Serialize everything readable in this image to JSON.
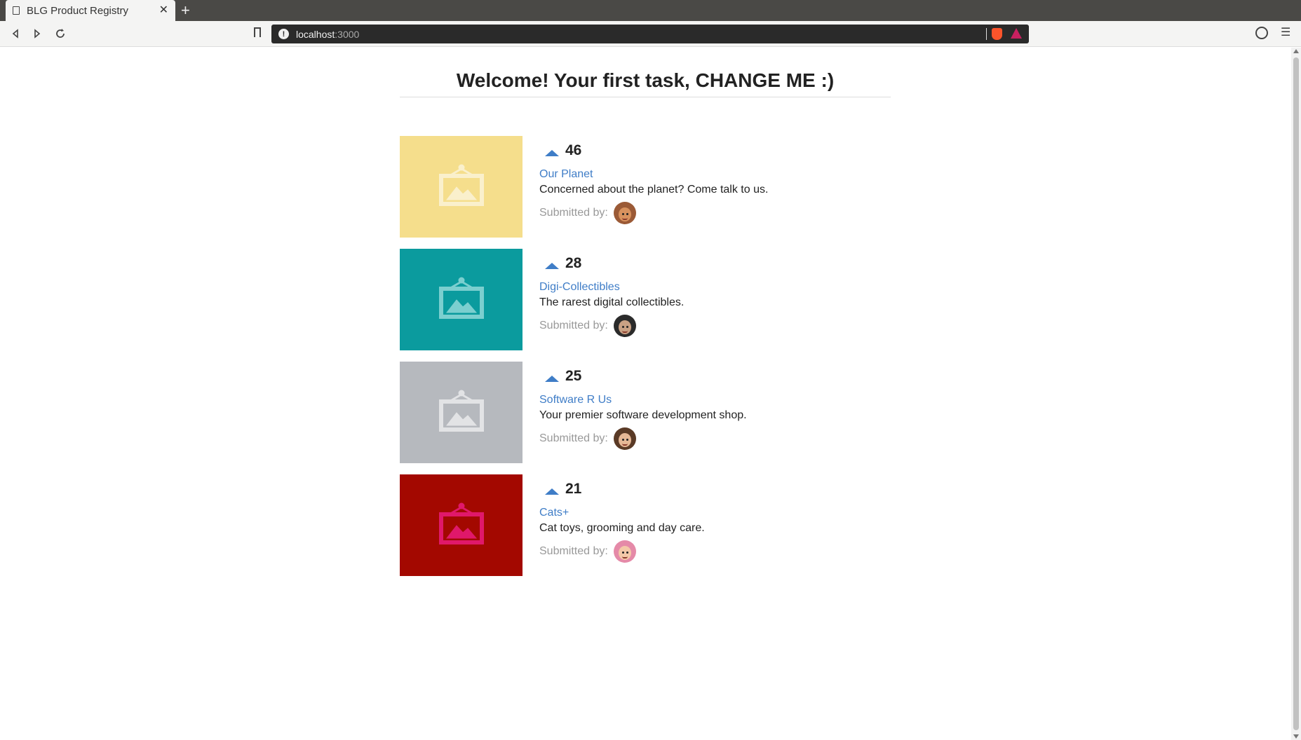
{
  "browser": {
    "tab_title": "BLG Product Registry",
    "tab_close": "✕",
    "new_tab": "+",
    "url_host": "localhost",
    "url_port": ":3000"
  },
  "page": {
    "title": "Welcome! Your first task, CHANGE ME :)"
  },
  "products": [
    {
      "votes": "46",
      "name": "Our Planet",
      "description": "Concerned about the planet? Come talk to us.",
      "submitted_label": "Submitted by:",
      "thumb_color": "#f5de8c",
      "icon_color": "#faf0cc",
      "avatar_bg": "#9b5a36",
      "avatar_face": "#d8925e"
    },
    {
      "votes": "28",
      "name": "Digi-Collectibles",
      "description": "The rarest digital collectibles.",
      "submitted_label": "Submitted by:",
      "thumb_color": "#0b9b9e",
      "icon_color": "#7bcfcf",
      "avatar_bg": "#2b2b2b",
      "avatar_face": "#c9a184"
    },
    {
      "votes": "25",
      "name": "Software R Us",
      "description": "Your premier software development shop.",
      "submitted_label": "Submitted by:",
      "thumb_color": "#b6b9be",
      "icon_color": "#e2e3e5",
      "avatar_bg": "#5a3a26",
      "avatar_face": "#e6b896"
    },
    {
      "votes": "21",
      "name": "Cats+",
      "description": "Cat toys, grooming and day care.",
      "submitted_label": "Submitted by:",
      "thumb_color": "#a30800",
      "icon_color": "#e0186a",
      "avatar_bg": "#e58aa8",
      "avatar_face": "#f4c9a8"
    }
  ],
  "colors": {
    "link": "#3f7dc7",
    "upvote": "#3f7dc7"
  }
}
